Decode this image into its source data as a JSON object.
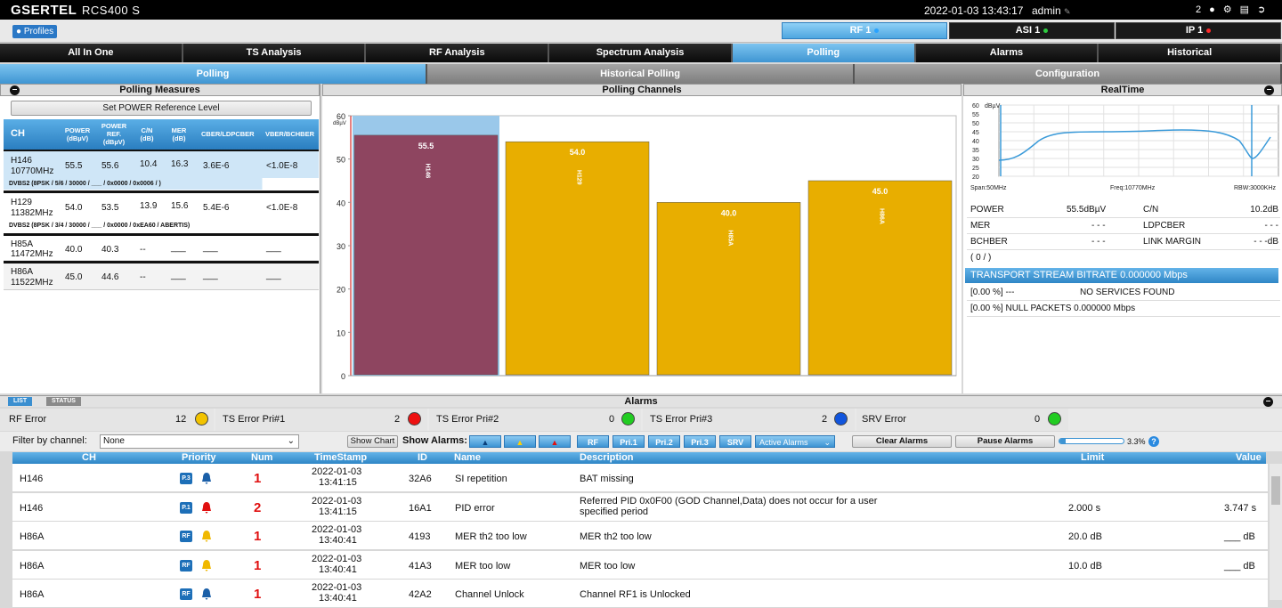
{
  "header": {
    "brand": "GSERTEL",
    "model": "RCS400 S",
    "datetime": "2022-01-03 13:43:17",
    "user": "admin",
    "notif_count": "2"
  },
  "profiles_label": "Profiles",
  "rf_tabs": [
    {
      "label": "RF 1",
      "status_color": "#29a3ff",
      "active": true
    },
    {
      "label": "ASI 1",
      "status_color": "#2ecc40",
      "active": false
    },
    {
      "label": "IP 1",
      "status_color": "#ff2b2b",
      "active": false
    }
  ],
  "main_tabs": [
    "All In One",
    "TS Analysis",
    "RF Analysis",
    "Spectrum Analysis",
    "Polling",
    "Alarms",
    "Historical"
  ],
  "active_main_tab": "Polling",
  "sub_tabs": [
    "Polling",
    "Historical Polling",
    "Configuration"
  ],
  "polling_measures": {
    "title": "Polling Measures",
    "set_ref_button": "Set POWER Reference Level",
    "headers": [
      "CH",
      "POWER (dBµV)",
      "POWER REF. (dBµV)",
      "C/N (dB)",
      "MER (dB)",
      "CBER/LDPCBER",
      "VBER/BCHBER"
    ],
    "rows": [
      {
        "ch": "H146",
        "freq": "10770MHz",
        "power": "55.5",
        "ref": "55.6",
        "cn": "10.4",
        "mer": "16.3",
        "cber": "3.6E-6",
        "vber": "<1.0E-8",
        "sub": "DVBS2 (8PSK / 5/6 / 30000 / ___ / 0x0000 / 0x0006 / )"
      },
      {
        "ch": "H129",
        "freq": "11382MHz",
        "power": "54.0",
        "ref": "53.5",
        "cn": "13.9",
        "mer": "15.6",
        "cber": "5.4E-6",
        "vber": "<1.0E-8",
        "sub": "DVBS2 (8PSK / 3/4 / 30000 / ___ / 0x0000 / 0xEA60 / ABERTIS)"
      },
      {
        "ch": "H85A",
        "freq": "11472MHz",
        "power": "40.0",
        "ref": "40.3",
        "cn": "--",
        "mer": "___",
        "cber": "___",
        "vber": "___",
        "sub": ""
      },
      {
        "ch": "H86A",
        "freq": "11522MHz",
        "power": "45.0",
        "ref": "44.6",
        "cn": "--",
        "mer": "___",
        "cber": "___",
        "vber": "___",
        "sub": ""
      }
    ]
  },
  "chart_data": {
    "type": "bar",
    "title": "Polling Channels",
    "ylabel": "dBµV",
    "ylim": [
      0,
      60
    ],
    "yticks": [
      0,
      10,
      20,
      30,
      40,
      50,
      60
    ],
    "categories": [
      "H146",
      "H129",
      "H85A",
      "H86A"
    ],
    "values": [
      55.5,
      54.0,
      40.0,
      45.0
    ],
    "value_labels": [
      "55.5",
      "54.0",
      "40.0",
      "45.0"
    ],
    "reference": [
      60,
      null,
      null,
      null
    ],
    "colors": [
      "#8e4560",
      "#e8ae00",
      "#e8ae00",
      "#e8ae00"
    ],
    "reference_color": "#9ac8ea"
  },
  "realtime": {
    "title": "RealTime",
    "chart": {
      "unit": "dBµV",
      "yticks": [
        "60",
        "55",
        "50",
        "45",
        "40",
        "35",
        "30",
        "25",
        "20"
      ],
      "span": "Span:50MHz",
      "freq": "Freq:10770MHz",
      "rbw": "RBW:3000KHz"
    },
    "measures": [
      {
        "l1": "POWER",
        "v1": "55.5dBµV",
        "l2": "C/N",
        "v2": "10.2dB"
      },
      {
        "l1": "MER",
        "v1": "- - -",
        "l2": "LDPCBER",
        "v2": "- - -"
      },
      {
        "l1": "BCHBER",
        "v1": "- - -",
        "l2": "LINK MARGIN",
        "v2": "- - -dB"
      }
    ],
    "services_count": "( 0 / )",
    "ts_bitrate": "TRANSPORT STREAM BITRATE 0.000000 Mbps",
    "line1_left": "[0.00 %] ---",
    "line1_right": "NO SERVICES FOUND",
    "line2": "[0.00 %] NULL PACKETS 0.000000 Mbps"
  },
  "alarms": {
    "title": "Alarms",
    "tabs": [
      "LIST",
      "STATUS"
    ],
    "counters": [
      {
        "label": "RF Error",
        "count": "12",
        "color": "#f2c300"
      },
      {
        "label": "TS Error Pri#1",
        "count": "2",
        "color": "#ee1111"
      },
      {
        "label": "TS Error Pri#2",
        "count": "0",
        "color": "#22cc22"
      },
      {
        "label": "TS Error Pri#3",
        "count": "2",
        "color": "#1155dd"
      },
      {
        "label": "SRV Error",
        "count": "0",
        "color": "#22cc22"
      }
    ],
    "filter_label": "Filter by channel:",
    "filter_value": "None",
    "show_chart": "Show Chart",
    "show_alarms_label": "Show Alarms:",
    "alarm_buttons": [
      "RF",
      "Pri.1",
      "Pri.2",
      "Pri.3",
      "SRV"
    ],
    "active_alarms_select": "Active Alarms",
    "clear_alarms": "Clear Alarms",
    "pause_alarms": "Pause Alarms",
    "progress_text": "3.3%",
    "progress_fraction": 0.033,
    "columns": [
      "CH",
      "Priority",
      "Num",
      "TimeStamp",
      "ID",
      "Name",
      "Description",
      "Limit",
      "Value"
    ],
    "rows": [
      {
        "ch": "H146",
        "pri": "P.3",
        "bell": "#1a5fa8",
        "num": "1",
        "date": "2022-01-03",
        "time": "13:41:15",
        "id": "32A6",
        "name": "SI repetition",
        "desc": "BAT missing",
        "desc2": "",
        "limit": "",
        "value": ""
      },
      {
        "ch": "H146",
        "pri": "P.1",
        "bell": "#e01010",
        "num": "2",
        "date": "2022-01-03",
        "time": "13:41:15",
        "id": "16A1",
        "name": "PID error",
        "desc": "Referred PID 0x0F00 (GOD Channel,Data) does not occur for a user",
        "desc2": "specified period",
        "limit": "2.000 s",
        "value": "3.747 s"
      },
      {
        "ch": "H86A",
        "pri": "RF",
        "bell": "#f0b800",
        "num": "1",
        "date": "2022-01-03",
        "time": "13:40:41",
        "id": "4193",
        "name": "MER th2 too low",
        "desc": "MER th2 too low",
        "desc2": "",
        "limit": "20.0 dB",
        "value": "___ dB"
      },
      {
        "ch": "H86A",
        "pri": "RF",
        "bell": "#f0b800",
        "num": "1",
        "date": "2022-01-03",
        "time": "13:40:41",
        "id": "41A3",
        "name": "MER too low",
        "desc": "MER too low",
        "desc2": "",
        "limit": "10.0 dB",
        "value": "___ dB"
      },
      {
        "ch": "H86A",
        "pri": "RF",
        "bell": "#1a5fa8",
        "num": "1",
        "date": "2022-01-03",
        "time": "13:40:41",
        "id": "42A2",
        "name": "Channel Unlock",
        "desc": "Channel RF1 is Unlocked",
        "desc2": "",
        "limit": "",
        "value": ""
      }
    ]
  }
}
